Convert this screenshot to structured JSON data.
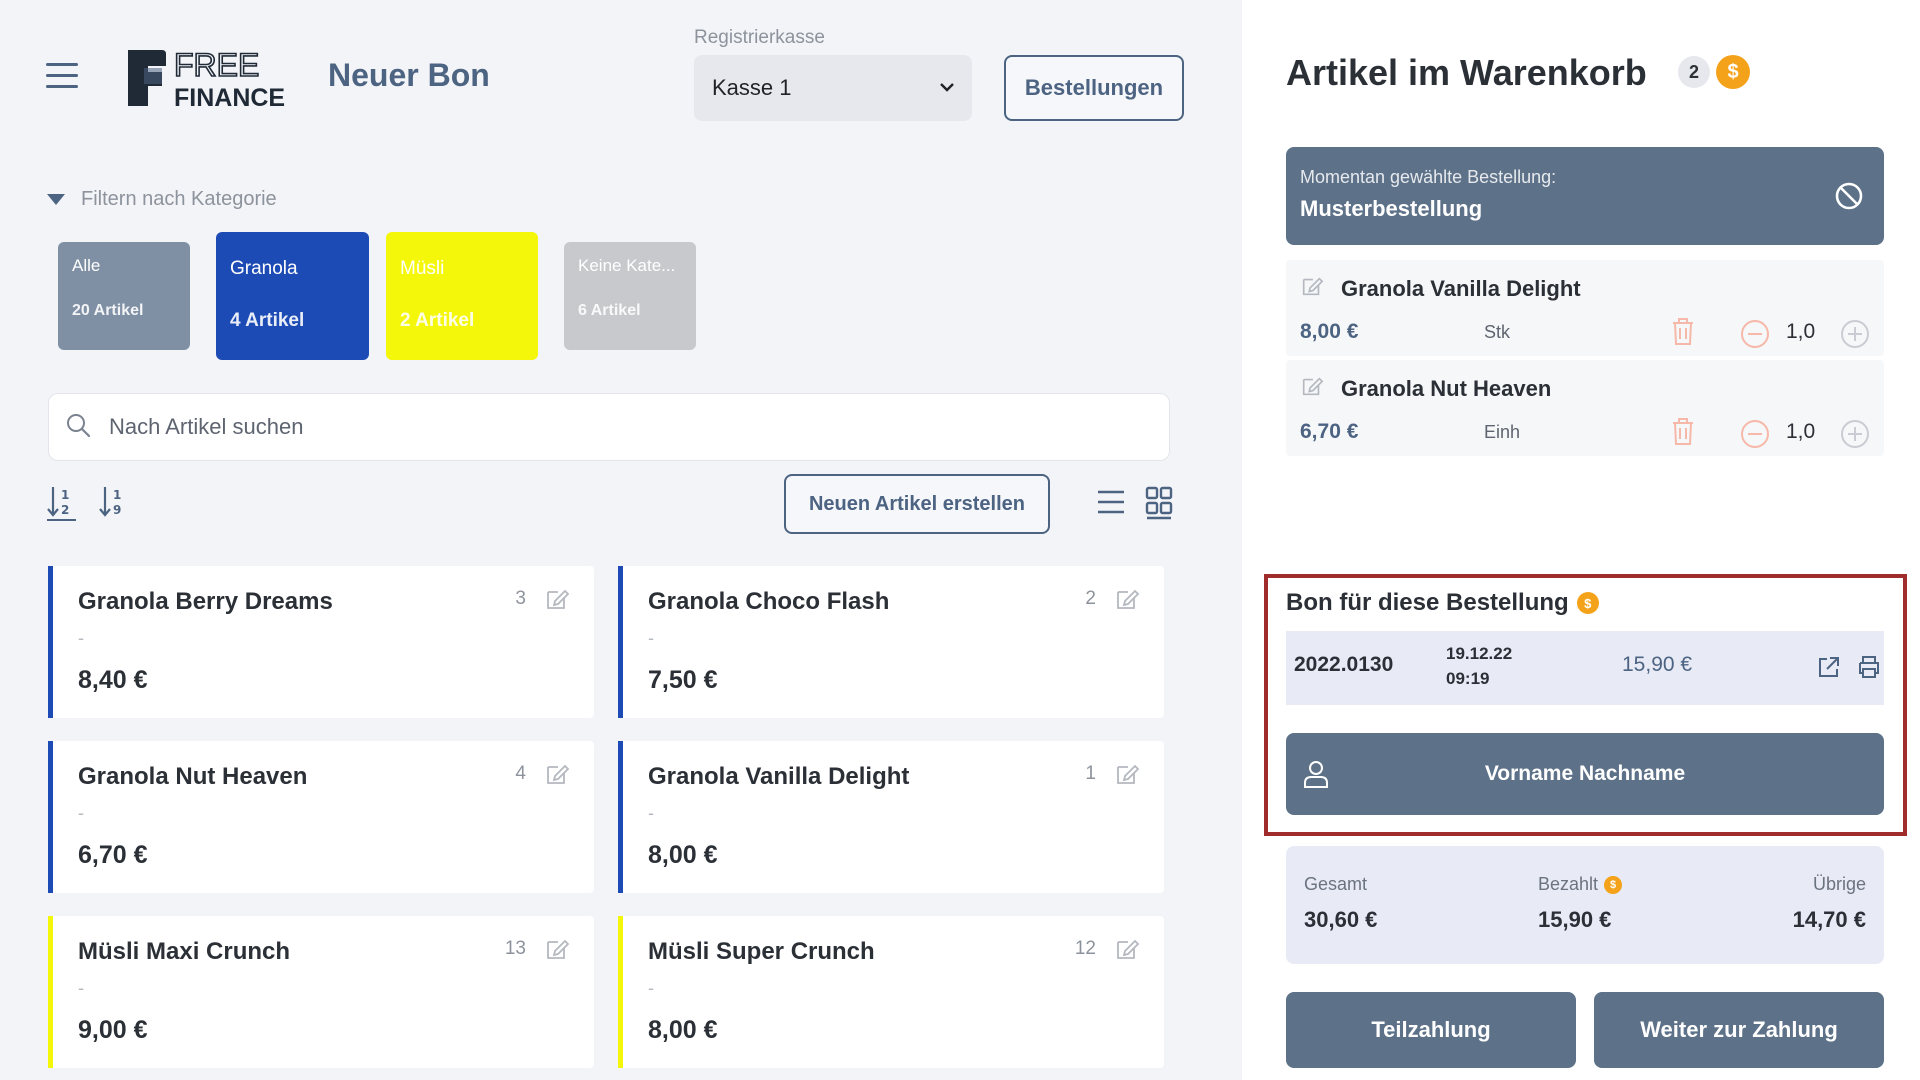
{
  "header": {
    "page_title": "Neuer Bon",
    "register_label": "Registrierkasse",
    "register_value": "Kasse 1",
    "orders_button": "Bestellungen",
    "logo_text_top": "FREE",
    "logo_text_bottom": "FINANCE"
  },
  "filter": {
    "toggle_label": "Filtern nach Kategorie",
    "categories": [
      {
        "name": "Alle",
        "count": "20 Artikel",
        "color": "#7f8fa4"
      },
      {
        "name": "Granola",
        "count": "4 Artikel",
        "color": "#1d4bb5"
      },
      {
        "name": "Müsli",
        "count": "2 Artikel",
        "color": "#f4f70a"
      },
      {
        "name": "Keine Kate...",
        "count": "6 Artikel",
        "color": "#c7c9cc"
      }
    ]
  },
  "search": {
    "placeholder": "Nach Artikel suchen"
  },
  "toolbar": {
    "new_item_button": "Neuen Artikel erstellen"
  },
  "products": [
    {
      "name": "Granola Berry Dreams",
      "qty": "3",
      "desc": "-",
      "price": "8,40 €",
      "color": "#1d4bb5"
    },
    {
      "name": "Granola Choco Flash",
      "qty": "2",
      "desc": "-",
      "price": "7,50 €",
      "color": "#1d4bb5"
    },
    {
      "name": "Granola Nut Heaven",
      "qty": "4",
      "desc": "-",
      "price": "6,70 €",
      "color": "#1d4bb5"
    },
    {
      "name": "Granola Vanilla Delight",
      "qty": "1",
      "desc": "-",
      "price": "8,00 €",
      "color": "#1d4bb5"
    },
    {
      "name": "Müsli Maxi Crunch",
      "qty": "13",
      "desc": "-",
      "price": "9,00 €",
      "color": "#f4f70a"
    },
    {
      "name": "Müsli Super Crunch",
      "qty": "12",
      "desc": "-",
      "price": "8,00 €",
      "color": "#f4f70a"
    }
  ],
  "cart": {
    "title": "Artikel im Warenkorb",
    "count": "2",
    "coin_symbol": "$",
    "selected_order_label": "Momentan gewählte Bestellung:",
    "selected_order_value": "Musterbestellung",
    "items": [
      {
        "name": "Granola Vanilla Delight",
        "price": "8,00 €",
        "unit": "Stk",
        "qty": "1,0"
      },
      {
        "name": "Granola Nut Heaven",
        "price": "6,70 €",
        "unit": "Einh",
        "qty": "1,0"
      }
    ]
  },
  "bon": {
    "title": "Bon für diese Bestellung",
    "number": "2022.0130",
    "date": "19.12.22",
    "time": "09:19",
    "amount": "15,90 €",
    "customer_button": "Vorname Nachname"
  },
  "totals": {
    "total_label": "Gesamt",
    "total_value": "30,60 €",
    "paid_label": "Bezahlt",
    "paid_value": "15,90 €",
    "remaining_label": "Übrige",
    "remaining_value": "14,70 €"
  },
  "actions": {
    "partial_payment": "Teilzahlung",
    "continue_payment": "Weiter zur Zahlung"
  },
  "colors": {
    "accent": "#4c6382",
    "panel": "#5d7189",
    "coin": "#f4a21a",
    "highlight_frame": "#a02c2c"
  }
}
